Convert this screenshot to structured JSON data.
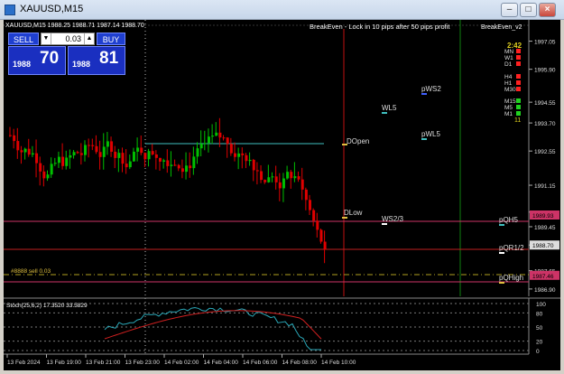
{
  "window": {
    "title": "XAUUSD,M15",
    "buttons": [
      "minimize-button",
      "maximize-button",
      "close-button"
    ]
  },
  "chart": {
    "info_line": "XAUUSD,M15  1988.25 1988.71 1987.14 1988.70",
    "banner": "BreakEven - Lock in 10 pips after 50 pips profit",
    "ea_name": "BreakEven_v2",
    "order_label": "#8888 sell 0.03",
    "price_scale": [
      "1997.05",
      "1995.90",
      "1994.55",
      "1993.70",
      "1992.55",
      "1991.15",
      "1990.05",
      "1989.45",
      "1988.70",
      "1987.65",
      "1986.90"
    ],
    "price_levels": [
      1997.05,
      1995.9,
      1994.55,
      1993.7,
      1992.55,
      1991.15,
      1990.05,
      1989.45,
      1988.7,
      1987.65,
      1986.9
    ],
    "price_range": [
      1986.6,
      1997.7
    ],
    "price_tags": [
      {
        "text": "1989.93",
        "price": 1989.93,
        "color": "#cc3366"
      },
      {
        "text": "1988.70",
        "price": 1988.7,
        "color": "#dddddd"
      },
      {
        "text": "1987.46",
        "price": 1987.46,
        "color": "#cc3366"
      }
    ],
    "time_scale": [
      "13 Feb 2024",
      "13 Feb 19:00",
      "13 Feb 21:00",
      "13 Feb 23:00",
      "14 Feb 02:00",
      "14 Feb 04:00",
      "14 Feb 06:00",
      "14 Feb 08:00",
      "14 Feb 10:00"
    ],
    "level_labels": [
      {
        "text": "DOpen",
        "color": "#dddddd"
      },
      {
        "text": "DLow",
        "color": "#dddddd"
      },
      {
        "text": "WL5",
        "color": "#dddddd"
      },
      {
        "text": "WS2/3",
        "color": "#dddddd"
      },
      {
        "text": "pWS2",
        "color": "#dddddd"
      },
      {
        "text": "pWL5",
        "color": "#dddddd"
      },
      {
        "text": "pQH5",
        "color": "#dddddd"
      },
      {
        "text": "pQR1/2",
        "color": "#dddddd"
      },
      {
        "text": "pQHigh",
        "color": "#dddddd"
      }
    ],
    "timer": "2:42",
    "tf_labels": [
      "MN",
      "W1",
      "D1",
      "H4",
      "H1",
      "M30",
      "M15",
      "M5",
      "M1"
    ],
    "tf_colors": [
      "#ff2020",
      "#ff2020",
      "#ff2020",
      "#ff2020",
      "#ff2020",
      "#ff2020",
      "#20d020",
      "#20d020",
      "#20d020"
    ],
    "tf_count": "11"
  },
  "trade_panel": {
    "sell_label": "SELL",
    "buy_label": "BUY",
    "lot_value": "0.03",
    "sell_price_small": "1988",
    "sell_price_big": "70",
    "buy_price_small": "1988",
    "buy_price_big": "81"
  },
  "oscillator": {
    "label": "Stoch(25,6,2) 17.3520 33.5829",
    "scale": [
      "100",
      "80",
      "50",
      "20",
      "0"
    ],
    "levels": [
      100,
      80,
      50,
      20,
      0
    ]
  },
  "colors": {
    "bull": "#00c000",
    "bear": "#e00000",
    "bg": "#000000",
    "grid": "#4a4a4a"
  }
}
